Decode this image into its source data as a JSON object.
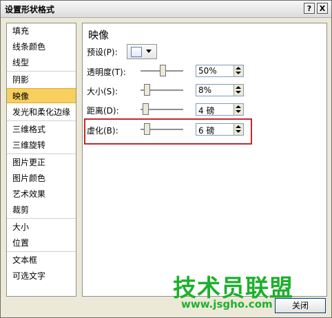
{
  "window": {
    "title": "设置形状格式",
    "help_label": "?",
    "close_label": "X"
  },
  "sidebar": {
    "items": [
      {
        "label": "填充"
      },
      {
        "label": "线条颜色"
      },
      {
        "label": "线型"
      },
      {
        "label": "阴影"
      },
      {
        "label": "映像"
      },
      {
        "label": "发光和柔化边缘"
      },
      {
        "label": "三维格式"
      },
      {
        "label": "三维旋转"
      },
      {
        "label": "图片更正"
      },
      {
        "label": "图片颜色"
      },
      {
        "label": "艺术效果"
      },
      {
        "label": "裁剪"
      },
      {
        "label": "大小"
      },
      {
        "label": "位置"
      },
      {
        "label": "文本框"
      },
      {
        "label": "可选文字"
      }
    ],
    "active_index": 4
  },
  "panel": {
    "title": "映像",
    "preset_label": "预设(P):",
    "rows": [
      {
        "label": "透明度(T):",
        "value": "50%",
        "level": 50
      },
      {
        "label": "大小(S):",
        "value": "8%",
        "level": 8
      },
      {
        "label": "距离(D):",
        "value": "4 磅",
        "level": 4
      },
      {
        "label": "虚化(B):",
        "value": "6 磅",
        "level": 6
      }
    ],
    "highlight_color": "#c0282d"
  },
  "footer": {
    "close_label": "关闭"
  },
  "watermark": {
    "text": "技术员联盟",
    "url": "www.jsgho.com"
  }
}
